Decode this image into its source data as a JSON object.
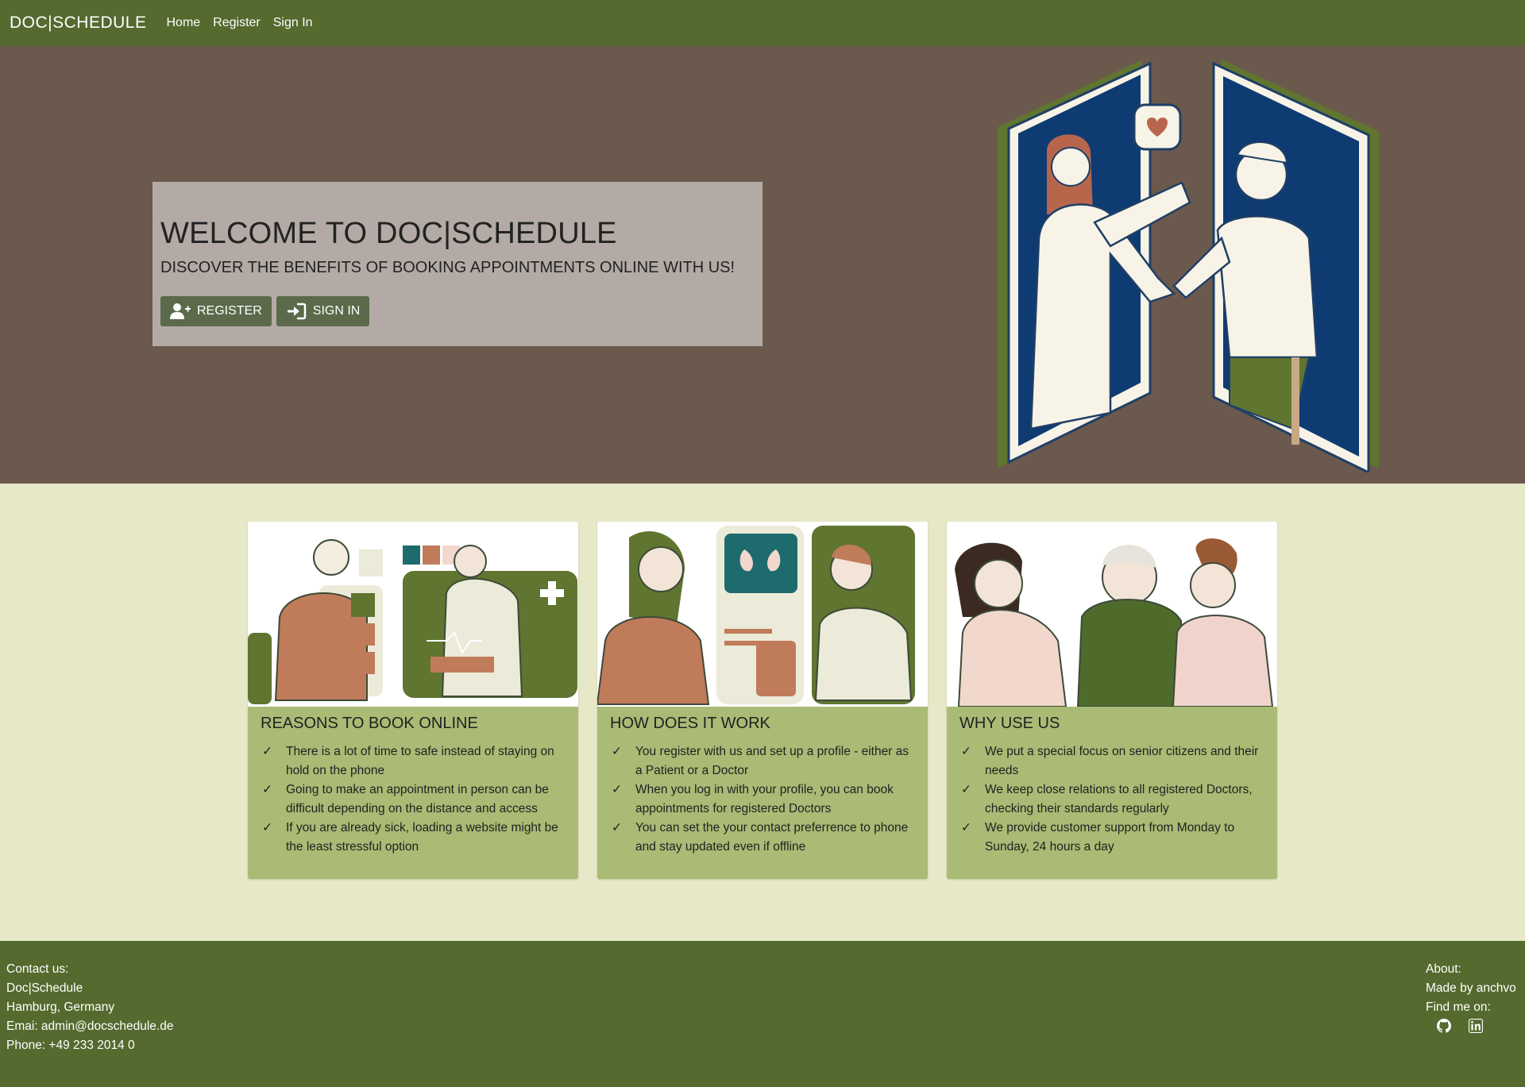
{
  "navbar": {
    "brand": "DOC|SCHEDULE",
    "links": [
      "Home",
      "Register",
      "Sign In"
    ]
  },
  "hero": {
    "title": "WELCOME TO DOC|SCHEDULE",
    "subtitle": "DISCOVER THE BENEFITS OF BOOKING APPOINTMENTS ONLINE WITH US!",
    "register_label": "REGISTER",
    "signin_label": "SIGN IN"
  },
  "cards": [
    {
      "title": "REASONS TO BOOK ONLINE",
      "items": [
        "There is a lot of time to safe instead of staying on hold on the phone",
        "Going to make an appointment in person can be difficult depending on the distance and access",
        "If you are already sick, loading a website might be the least stressful option"
      ]
    },
    {
      "title": "HOW DOES IT WORK",
      "items": [
        "You register with us and set up a profile - either as a Patient or a Doctor",
        "When you log in with your profile, you can book appointments for registered Doctors",
        "You can set the your contact preferrence to phone and stay updated even if offline"
      ]
    },
    {
      "title": "WHY USE US",
      "items": [
        "We put a special focus on senior citizens and their needs",
        "We keep close relations to all registered Doctors, checking their standards regularly",
        "We provide customer support from Monday to Sunday, 24 hours a day"
      ]
    }
  ],
  "check_glyph": "✓",
  "footer": {
    "contact": {
      "heading": "Contact us:",
      "name": "Doc|Schedule",
      "city": "Hamburg, Germany",
      "email": "Emai: admin@docschedule.de",
      "phone": "Phone: +49 233 2014 0"
    },
    "about": {
      "heading": "About:",
      "made_by": "Made by anchvo",
      "find_me": "Find me on:",
      "icons": [
        "github-icon",
        "linkedin-icon"
      ]
    }
  },
  "colors": {
    "navbar": "#546a2e",
    "hero_bg": "#6b594e",
    "page_bg": "#e7e8c8",
    "card_bg": "#a9bb74",
    "button": "#5a6a4a"
  }
}
